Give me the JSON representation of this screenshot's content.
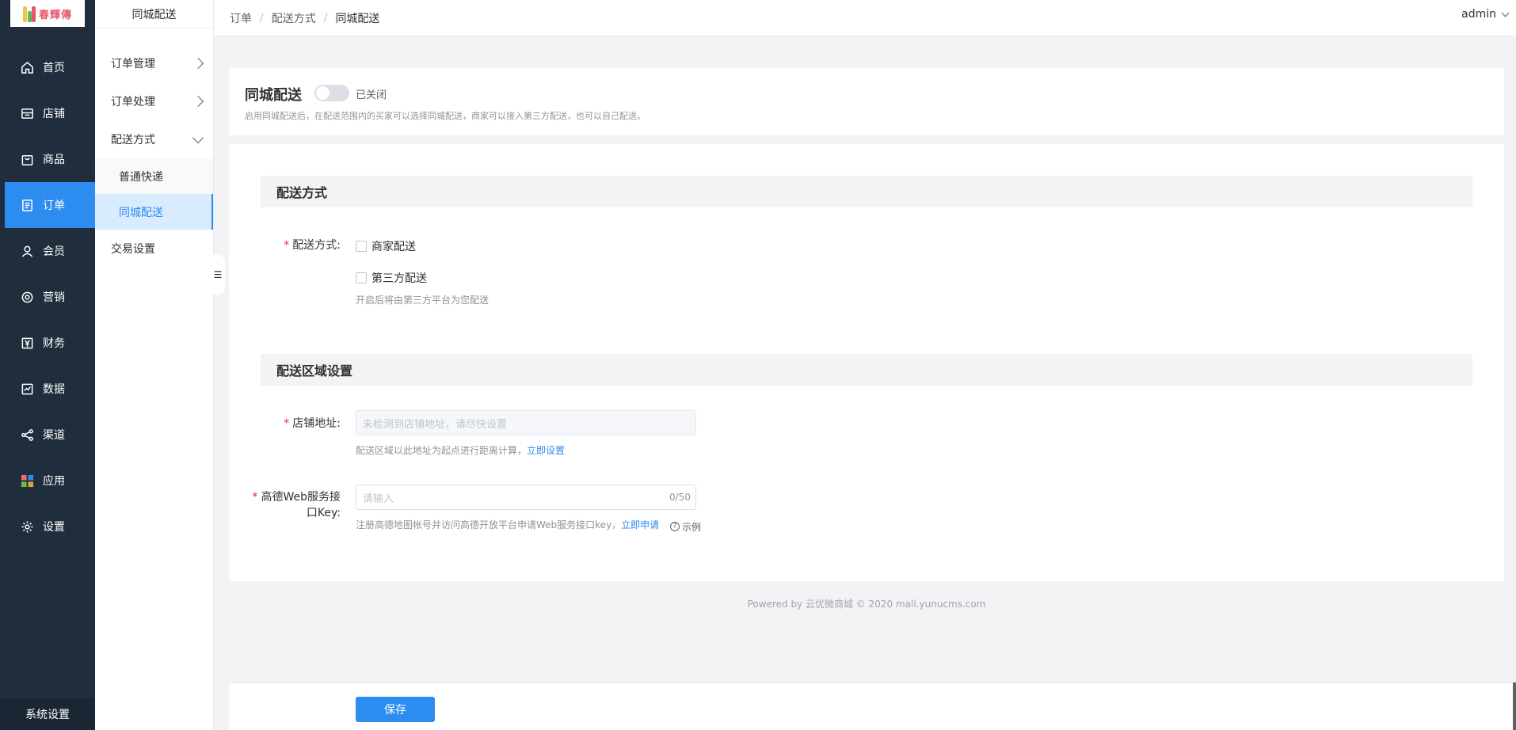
{
  "app": {
    "logo_text": "春輝傳"
  },
  "sidebar": {
    "items": [
      {
        "label": "首页",
        "icon": "home-icon"
      },
      {
        "label": "店铺",
        "icon": "store-icon"
      },
      {
        "label": "商品",
        "icon": "bag-icon"
      },
      {
        "label": "订单",
        "icon": "order-icon",
        "active": true
      },
      {
        "label": "会员",
        "icon": "user-icon"
      },
      {
        "label": "营销",
        "icon": "marketing-icon"
      },
      {
        "label": "财务",
        "icon": "yen-icon"
      },
      {
        "label": "数据",
        "icon": "chart-icon"
      },
      {
        "label": "渠道",
        "icon": "share-icon"
      },
      {
        "label": "应用",
        "icon": "apps-icon"
      },
      {
        "label": "设置",
        "icon": "gear-icon"
      }
    ],
    "bottom_label": "系统设置"
  },
  "submenu": {
    "title": "同城配送",
    "items": [
      {
        "label": "订单管理"
      },
      {
        "label": "订单处理"
      },
      {
        "label": "配送方式"
      },
      {
        "label": "交易设置"
      }
    ],
    "children": [
      {
        "label": "普通快递"
      },
      {
        "label": "同城配送",
        "active": true
      }
    ]
  },
  "header": {
    "breadcrumb": [
      "订单",
      "配送方式",
      "同城配送"
    ],
    "user": "admin"
  },
  "top_card": {
    "title": "同城配送",
    "switch_label": "已关闭",
    "switch_on": false,
    "description": "启用同城配送后，在配送范围内的买家可以选择同城配送，商家可以接入第三方配送，也可以自己配送。"
  },
  "delivery_section": {
    "title": "配送方式",
    "label": "配送方式:",
    "option_merchant": "商家配送",
    "option_third_party": "第三方配送",
    "hint": "开启后将由第三方平台为您配送"
  },
  "area_section": {
    "title": "配送区域设置",
    "address_label": "店铺地址:",
    "address_placeholder": "未检测到店铺地址，请尽快设置",
    "address_hint": "配送区域以此地址为起点进行距离计算，",
    "address_link": "立即设置",
    "key_label_line1": "高德Web服务接",
    "key_label_line2": "口Key:",
    "key_placeholder": "请输入",
    "key_count": "0/50",
    "key_hint": "注册高德地图帐号并访问高德开放平台申请Web服务接口key，",
    "key_link": "立即申请",
    "example_label": "示例"
  },
  "footer": {
    "text": "Powered by 云优微商城 © 2020 mall.yunucms.com"
  },
  "actions": {
    "save_label": "保存"
  },
  "colors": {
    "accent": "#2d8cf0",
    "sidebar_bg": "#1f2d3d",
    "required": "#f5222d"
  }
}
